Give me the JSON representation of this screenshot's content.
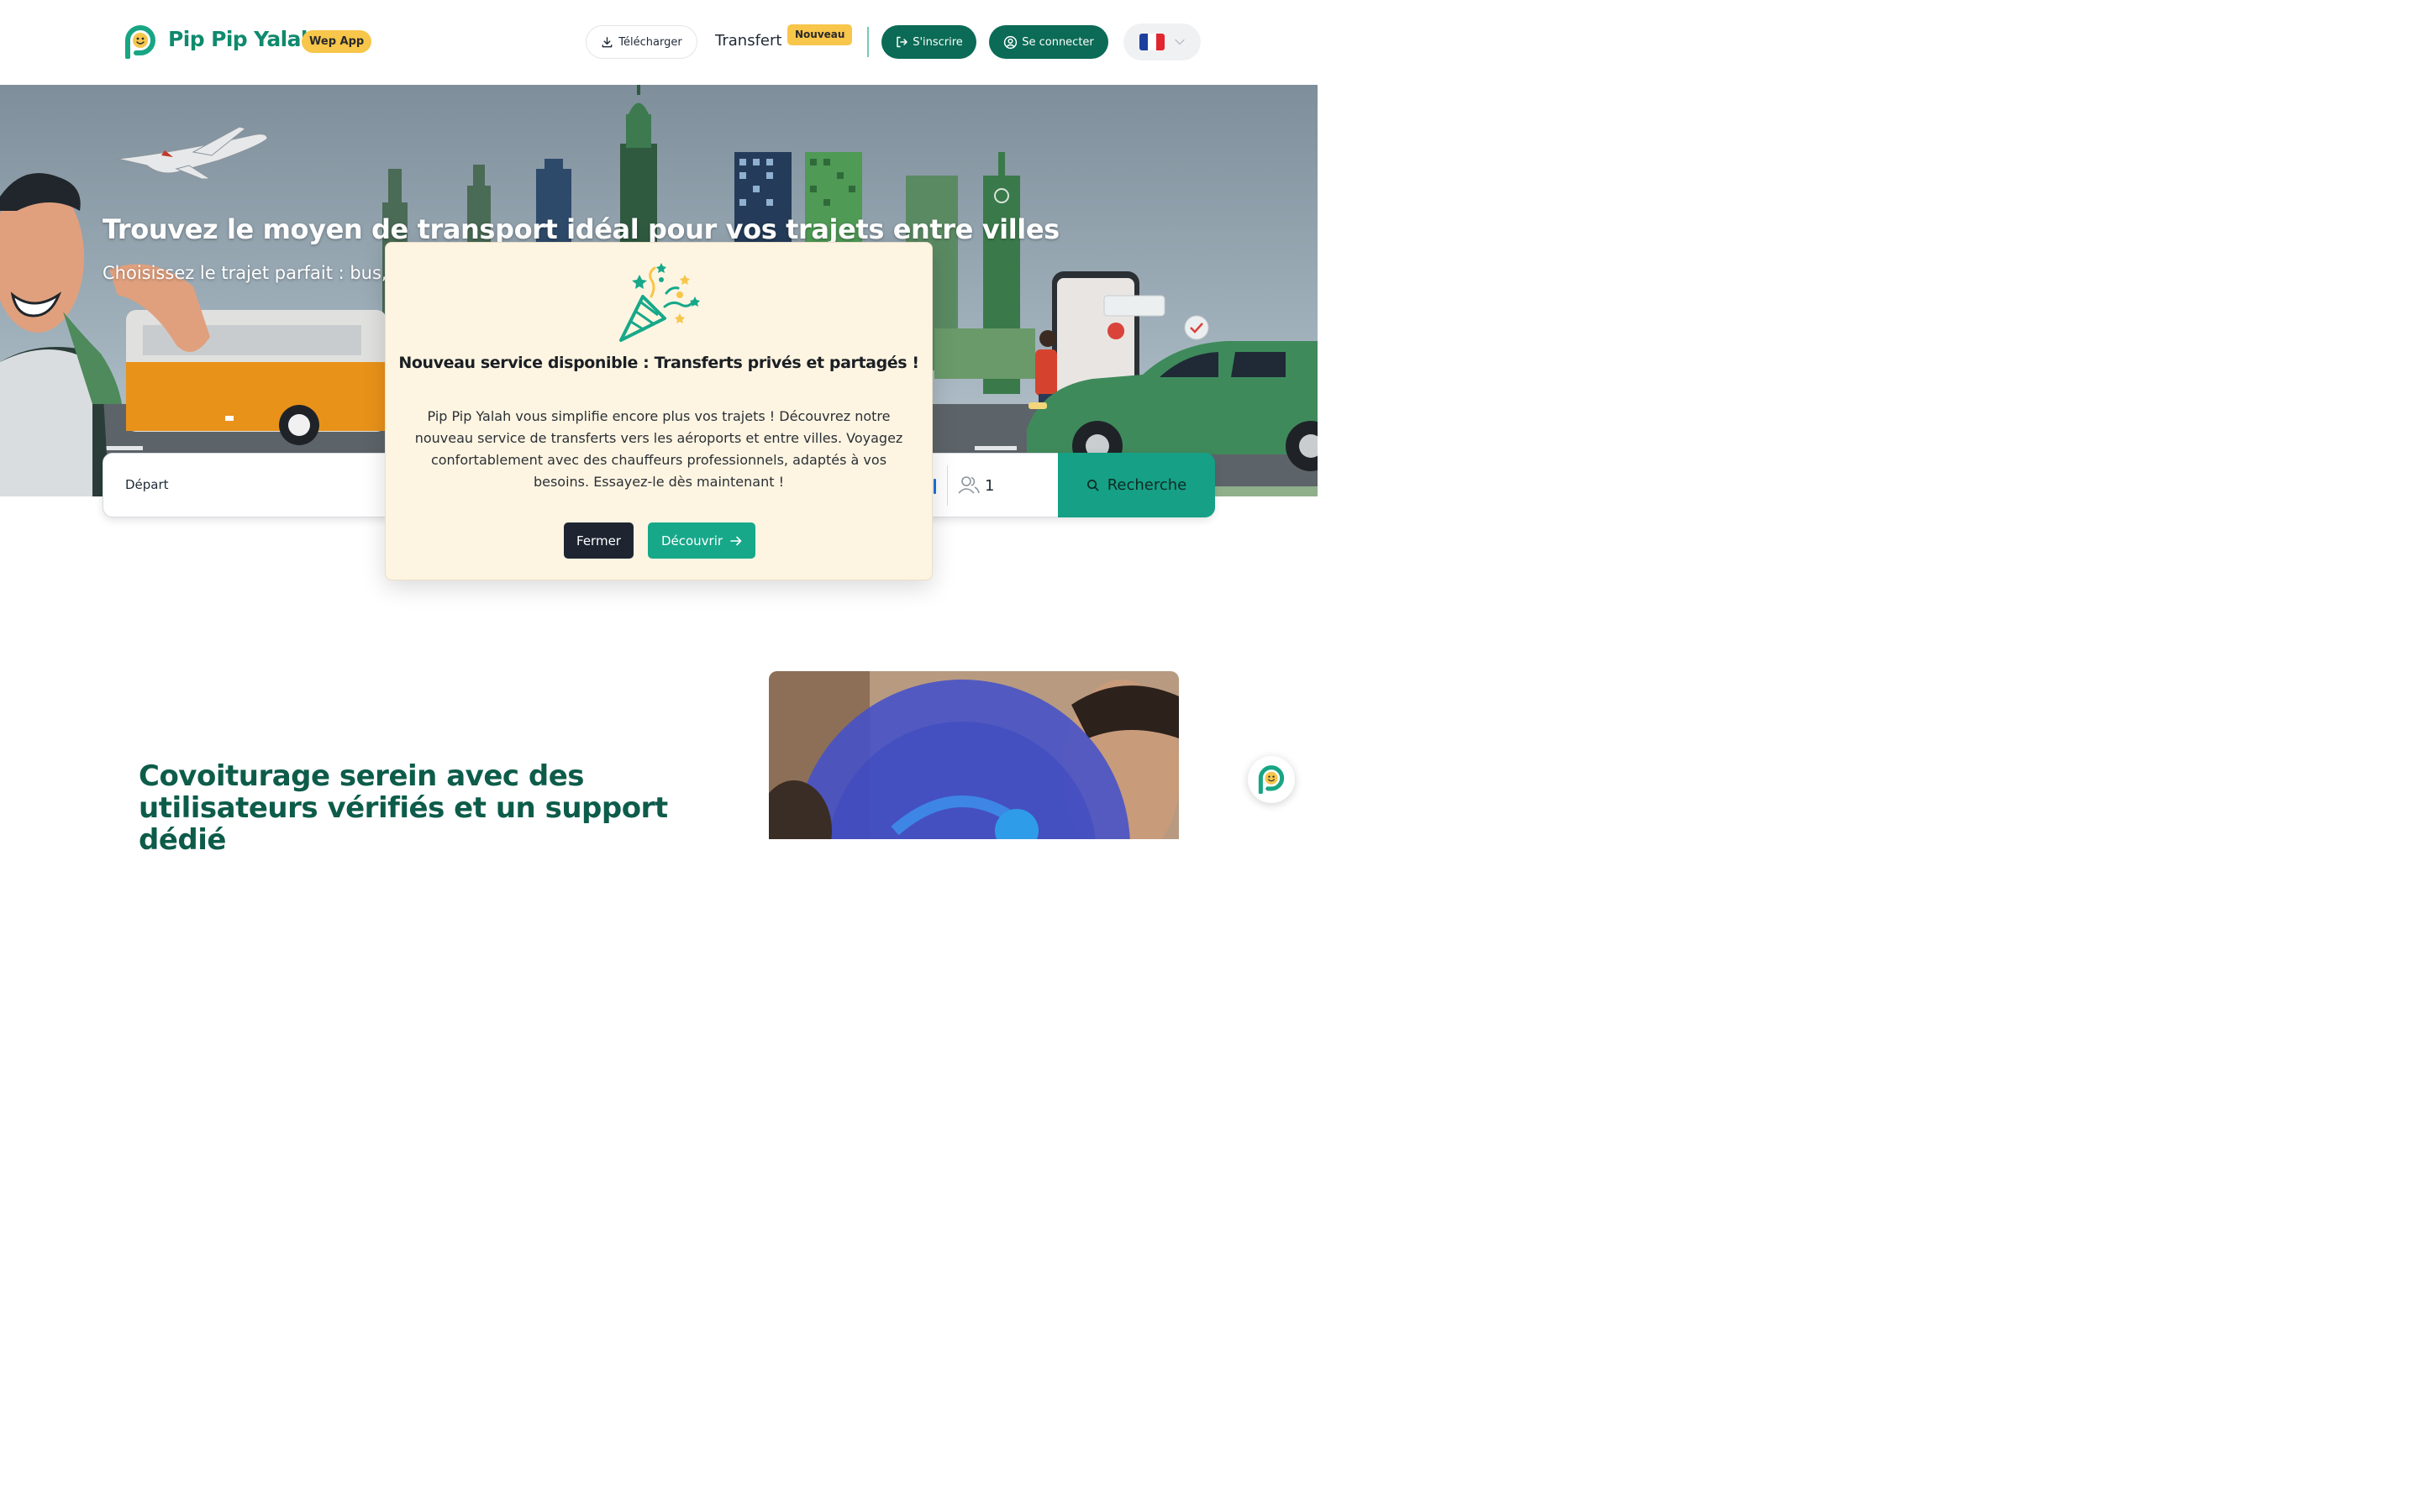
{
  "header": {
    "brand": "Pip Pip Yalah",
    "webapp_badge": "Wep App",
    "download_label": "Télécharger",
    "transfer_label": "Transfert",
    "new_badge": "Nouveau",
    "signup_label": "S'inscrire",
    "login_label": "Se connecter",
    "language": {
      "icon": "french-flag-icon",
      "colors": [
        "#1d3f9e",
        "#ffffff",
        "#e1262d"
      ]
    }
  },
  "hero": {
    "title": "Trouvez le moyen de transport idéal pour vos trajets entre villes",
    "subtitle": "Choisissez le trajet parfait : bus, covoiturage ou transfert, et réservez facilement"
  },
  "search": {
    "departure_label": "Départ",
    "passengers": "1",
    "search_label": "Recherche"
  },
  "modal": {
    "icon": "party-popper-icon",
    "title": "Nouveau service disponible : Transferts privés et partagés !",
    "body": "Pip Pip Yalah vous simplifie encore plus vos trajets ! Découvrez notre nouveau service de transferts vers les aéroports et entre villes. Voyagez confortablement avec des chauffeurs professionnels, adaptés à vos besoins. Essayez-le dès maintenant !",
    "close_label": "Fermer",
    "discover_label": "Découvrir"
  },
  "section": {
    "title": "Covoiturage serein avec des utilisateurs vérifiés et un support dédié"
  },
  "colors": {
    "primary": "#0b6b56",
    "accent": "#16a085",
    "badge": "#f7c64a",
    "modal_bg": "#fdf5e2"
  }
}
